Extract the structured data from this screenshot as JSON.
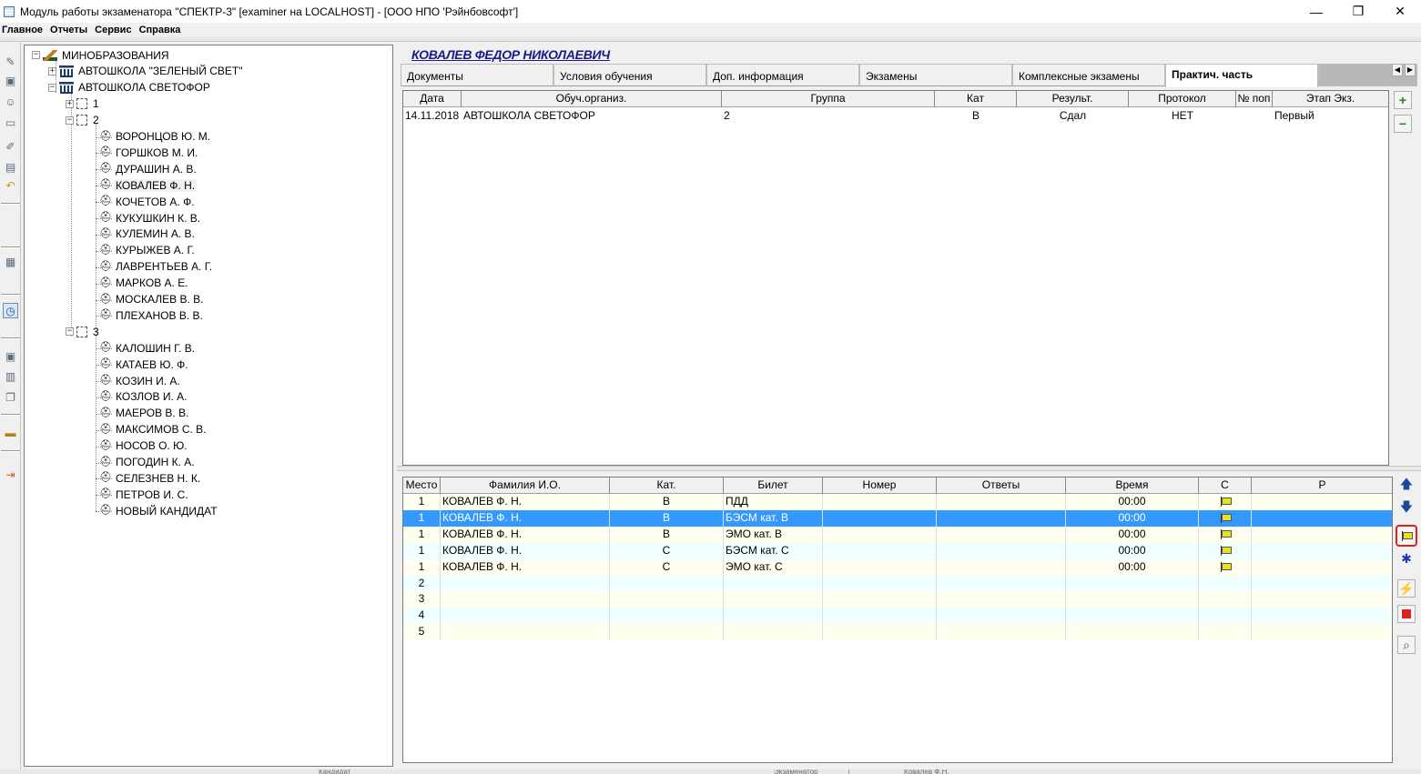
{
  "window": {
    "title": "Модуль работы экзаменатора \"СПЕКТР-3\" [examiner на LOCALHOST] - [ООО НПО 'Рэйнбовсофт']",
    "min_glyph": "—",
    "max_glyph": "❐",
    "close_glyph": "✕"
  },
  "menu": [
    "Главное",
    "Отчеты",
    "Сервис",
    "Справка"
  ],
  "tree": {
    "root": "МИНОБРАЗОВАНИЯ",
    "school_1": "АВТОШКОЛА \"ЗЕЛЕНЫЙ СВЕТ\"",
    "school_2": "АВТОШКОЛА СВЕТОФОР",
    "group_1": "1",
    "group_2": "2",
    "group_2_members": [
      "ВОРОНЦОВ Ю. М.",
      "ГОРШКОВ М. И.",
      "ДУРАШИН А. В.",
      "КОВАЛЕВ Ф. Н.",
      "КОЧЕТОВ А. Ф.",
      "КУКУШКИН К. В.",
      "КУЛЕМИН А. В.",
      "КУРЫЖЕВ А. Г.",
      "ЛАВРЕНТЬЕВ А. Г.",
      "МАРКОВ А. Е.",
      "МОСКАЛЕВ В. В.",
      "ПЛЕХАНОВ В. В."
    ],
    "group_3": "3",
    "group_3_members": [
      "КАЛОШИН Г. В.",
      "КАТАЕВ Ю. Ф.",
      "КОЗИН И. А.",
      "КОЗЛОВ И. А.",
      "МАЕРОВ В. В.",
      "МАКСИМОВ С. В.",
      "НОСОВ О. Ю.",
      "ПОГОДИН К. А.",
      "СЕЛЕЗНЕВ Н. К.",
      "ПЕТРОВ И. С.",
      "НОВЫЙ КАНДИДАТ"
    ],
    "selected": "КОВАЛЕВ Ф. Н."
  },
  "person_name": "КОВАЛЕВ ФЕДОР НИКОЛАЕВИЧ",
  "tabs": [
    "Документы",
    "Условия обучения",
    "Доп. информация",
    "Экзамены",
    "Комплексные экзамены",
    "Практич. часть"
  ],
  "active_tab": "Практич. часть",
  "exams_grid": {
    "headers": [
      "Дата",
      "Обуч.организ.",
      "Группа",
      "Кат",
      "Результ.",
      "Протокол",
      "№ поп",
      "Этап Экз."
    ],
    "rows": [
      [
        "14.11.2018",
        "АВТОШКОЛА СВЕТОФОР",
        "2",
        "В",
        "Сдал",
        "НЕТ",
        "",
        "Первый"
      ]
    ]
  },
  "tickets_grid": {
    "headers": [
      "Место",
      "Фамилия И.О.",
      "Кат.",
      "Билет",
      "Номер",
      "Ответы",
      "Время",
      "С",
      "Р"
    ],
    "rows": [
      [
        "1",
        "КОВАЛЕВ Ф. Н.",
        "В",
        "ПДД",
        "",
        "",
        "00:00",
        "flag",
        ""
      ],
      [
        "1",
        "КОВАЛЕВ Ф. Н.",
        "В",
        "БЭСМ кат. В",
        "",
        "",
        "00:00",
        "flag",
        ""
      ],
      [
        "1",
        "КОВАЛЕВ Ф. Н.",
        "В",
        "ЭМО кат. В",
        "",
        "",
        "00:00",
        "flag",
        ""
      ],
      [
        "1",
        "КОВАЛЕВ Ф. Н.",
        "С",
        "БЭСМ кат. С",
        "",
        "",
        "00:00",
        "flag",
        ""
      ],
      [
        "1",
        "КОВАЛЕВ Ф. Н.",
        "С",
        "ЭМО кат. С",
        "",
        "",
        "00:00",
        "flag",
        ""
      ],
      [
        "2",
        "",
        "",
        "",
        "",
        "",
        "",
        "",
        ""
      ],
      [
        "3",
        "",
        "",
        "",
        "",
        "",
        "",
        "",
        ""
      ],
      [
        "4",
        "",
        "",
        "",
        "",
        "",
        "",
        "",
        ""
      ],
      [
        "5",
        "",
        "",
        "",
        "",
        "",
        "",
        "",
        ""
      ]
    ],
    "selected_row": 1
  },
  "buttons": {
    "add": "+",
    "remove": "−",
    "up": "🡅",
    "down": "🡇",
    "flag": "flag-icon",
    "gear": "gear-icon",
    "lightning": "⚡",
    "stop": "stop-icon",
    "zoom": "zoom-icon"
  },
  "icons": {
    "school": "school-icon",
    "person": "⛑",
    "expand": "+",
    "collapse": "−"
  },
  "status": {
    "left": "Кандидат",
    "mid": "Экзаменатор",
    "right": "Ковалев Ф.Н."
  }
}
